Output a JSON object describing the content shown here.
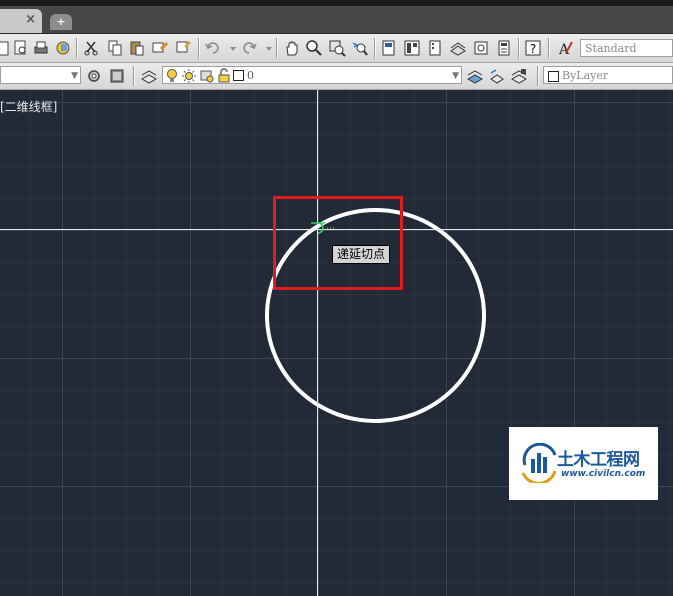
{
  "menubar": {
    "visible": true
  },
  "tabs": {
    "close_glyph": "×",
    "new_tab_glyph": "+"
  },
  "toolbar1": {
    "icons": [
      "sheet-set-icon",
      "plot-preview-icon",
      "plot-icon",
      "publish-3d-icon",
      "cut-icon",
      "copy-icon",
      "paste-icon",
      "match-properties-icon",
      "undo-icon",
      "redo-icon",
      "pan-icon",
      "zoom-realtime-icon",
      "zoom-window-icon",
      "zoom-previous-icon",
      "properties-icon",
      "design-center-icon",
      "tool-palettes-icon",
      "sheet-set-manager-icon",
      "markup-icon",
      "quickcalc-icon",
      "help-icon",
      "text-style-icon"
    ],
    "text_style_value": "Standard"
  },
  "toolbar2": {
    "workspace_value": "",
    "layer_value": "0",
    "color_value": "ByLayer"
  },
  "viewport": {
    "view_label": "[二维线框]",
    "tooltip": "递延切点"
  },
  "watermark": {
    "title": "土木工程网",
    "url": "www.civilcn.com"
  },
  "colors": {
    "canvas": "#232a37",
    "highlight": "#e01c1c",
    "snap_marker": "#2fd45a",
    "circle": "#ffffff"
  }
}
